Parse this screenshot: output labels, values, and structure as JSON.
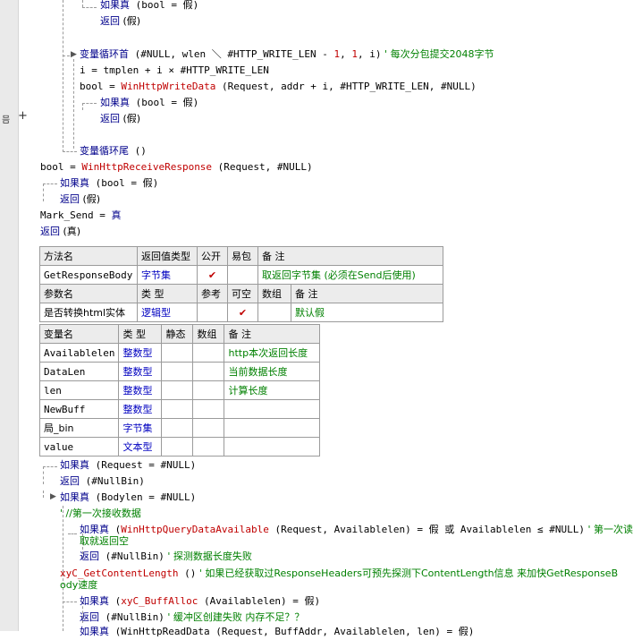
{
  "code_top": {
    "l01_kw": "返回",
    "l01_rest": " (假)",
    "l00_kw": "如果真",
    "l00_rest": " (bool = 假)",
    "l02_kw": "变量循环首",
    "l02_a": " (#NULL, wlen ＼ #HTTP_WRITE_LEN - ",
    "l02_n1": "1",
    "l02_b": ", ",
    "l02_n2": "1",
    "l02_c": ", i)",
    "l02_cm": "  ' 每次分包提交2048字节",
    "l03": "i = tmplen + i × #HTTP_WRITE_LEN",
    "l04_a": "bool = ",
    "l04_fn": "WinHttpWriteData",
    "l04_b": " (Request, addr + i, #HTTP_WRITE_LEN, #NULL)",
    "l05_kw": "如果真",
    "l05_rest": " (bool = 假)",
    "l06_kw": "返回",
    "l06_rest": " (假)",
    "l07_kw": "变量循环尾",
    "l07_rest": " ()",
    "l08_a": "bool = ",
    "l08_fn": "WinHttpReceiveResponse",
    "l08_b": " (Request, #NULL)",
    "l09_kw": "如果真",
    "l09_rest": " (bool = 假)",
    "l10_kw": "返回",
    "l10_rest": " (假)",
    "l11": "Mark_Send = ",
    "l11_kw": "真",
    "l12_kw": "返回",
    "l12_rest": " (真)"
  },
  "method_table": {
    "headers": [
      "方法名",
      "返回值类型",
      "公开",
      "易包",
      "备 注"
    ],
    "name": "GetResponseBody",
    "return_type": "字节集",
    "public_mark": "✔",
    "remark": "取返回字节集 (必须在Send后使用)",
    "param_headers": [
      "参数名",
      "类 型",
      "参考",
      "可空",
      "数组",
      "备 注"
    ],
    "param_name": "是否转换html实体",
    "param_type": "逻辑型",
    "param_nullable_mark": "✔",
    "param_remark": "默认假"
  },
  "var_table": {
    "headers": [
      "变量名",
      "类 型",
      "静态",
      "数组",
      "备 注"
    ],
    "rows": [
      {
        "name": "Availablelen",
        "type": "整数型",
        "remark": "http本次返回长度"
      },
      {
        "name": "DataLen",
        "type": "整数型",
        "remark": "当前数据长度"
      },
      {
        "name": "len",
        "type": "整数型",
        "remark": "计算长度"
      },
      {
        "name": "NewBuff",
        "type": "整数型",
        "remark": ""
      },
      {
        "name": "局_bin",
        "type": "字节集",
        "remark": ""
      },
      {
        "name": "value",
        "type": "文本型",
        "remark": ""
      }
    ]
  },
  "code_bottom": {
    "b01_kw": "如果真",
    "b01_rest": " (Request = #NULL)",
    "b02_kw": "返回",
    "b02_rest": " (#NullBin)",
    "b03_kw": "如果真",
    "b03_rest": " (Bodylen = #NULL)",
    "b04_cm": "' //第一次接收数据",
    "b05_kw": "如果真",
    "b05_a": " (",
    "b05_fn": "WinHttpQueryDataAvailable",
    "b05_b": " (Request, Availablelen) = 假 或 Availablelen ≤ #NULL)",
    "b05_cm": "  ' 第一次读",
    "b05_cm2": "取就返回空",
    "b06_kw": "返回",
    "b06_rest": " (#NullBin)",
    "b06_cm": "  ' 探测数据长度失败",
    "b07_fn": "xyC_GetContentLength",
    "b07_rest": " ()",
    "b07_cm": "  ' 如果已经获取过ResponseHeaders可预先探测下ContentLength信息 来加快GetResponseB",
    "b07_cm2": "ody速度",
    "b08_kw": "如果真",
    "b08_a": " (",
    "b08_fn": "xyC_BuffAlloc",
    "b08_b": " (Availablelen) = 假)",
    "b09_kw": "返回",
    "b09_rest": " (#NullBin)",
    "b09_cm": "  ' 缓冲区创建失败 内存不足？？",
    "b10_kw": "如果真",
    "b10_rest": " (WinHttpReadData (Request, BuffAddr, Availablelen, len) = 假)"
  },
  "icons": {
    "fold_glyph": "믐",
    "fold_plus": "+"
  }
}
